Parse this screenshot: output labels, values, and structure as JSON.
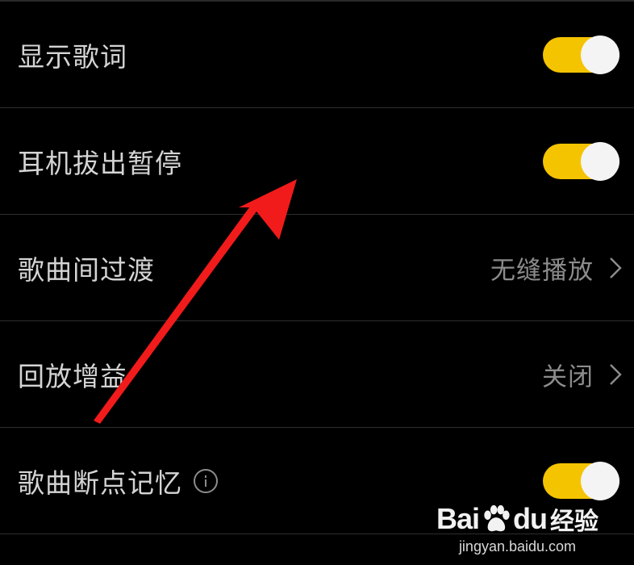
{
  "settings": {
    "rows": [
      {
        "label": "显示歌词",
        "type": "toggle",
        "enabled": true
      },
      {
        "label": "耳机拔出暂停",
        "type": "toggle",
        "enabled": true
      },
      {
        "label": "歌曲间过渡",
        "type": "value",
        "value": "无缝播放"
      },
      {
        "label": "回放增益",
        "type": "value",
        "value": "关闭"
      },
      {
        "label": "歌曲断点记忆",
        "type": "toggle",
        "enabled": true,
        "has_info": true
      }
    ]
  },
  "colors": {
    "toggle_on": "#f5c400",
    "knob": "#f4f4f4",
    "arrow": "#f21b1b",
    "background": "#000000"
  },
  "watermark": {
    "brand_latin_1": "Bai",
    "brand_latin_2": "du",
    "brand_cn": "经验",
    "url": "jingyan.baidu.com"
  }
}
